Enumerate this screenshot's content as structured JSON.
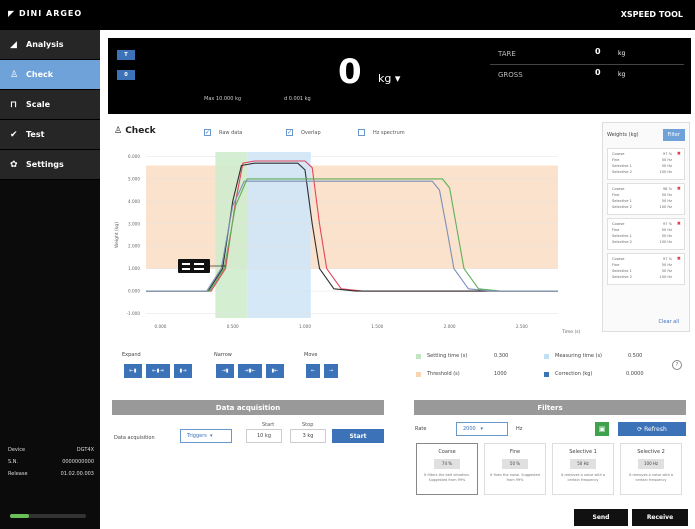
{
  "topbar": {
    "logo": "◤ DINI ARGEO",
    "app_title": "XSPEED TOOL"
  },
  "sidebar": {
    "items": [
      {
        "label": "Analysis",
        "icon": "chart-icon"
      },
      {
        "label": "Check",
        "icon": "check-user-icon"
      },
      {
        "label": "Scale",
        "icon": "scale-icon"
      },
      {
        "label": "Test",
        "icon": "checkmark-icon"
      },
      {
        "label": "Settings",
        "icon": "gear-icon"
      }
    ],
    "device": [
      {
        "label": "Device",
        "value": "DGT4X"
      },
      {
        "label": "S.N.",
        "value": "0000000000"
      },
      {
        "label": "Release",
        "value": "01.02.00.003"
      }
    ],
    "progress": 0.25
  },
  "display": {
    "btn_t": "T",
    "btn_0": "0",
    "weight": "0",
    "unit": "kg",
    "max": "Max 10.000 kg",
    "division": "d 0.001 kg",
    "tare_label": "TARE",
    "tare_value": "0",
    "tare_unit": "kg",
    "gross_label": "GROSS",
    "gross_value": "0",
    "gross_unit": "kg"
  },
  "check": {
    "title": "Check",
    "raw_data": "Raw data",
    "overlap": "Overlap",
    "hz_spectrum": "Hz spectrum",
    "raw_data_checked": true,
    "overlap_checked": true,
    "hz_spectrum_checked": false
  },
  "chart_data": {
    "type": "line",
    "ylabel": "Weight (kg)",
    "xlabel": "Time (s)",
    "yticks": [
      "6.000",
      "5.000",
      "4.000",
      "3.000",
      "2.000",
      "1.000",
      "0.000",
      "-1.000"
    ],
    "xticks": [
      "0.000",
      "0.500",
      "1.000",
      "1.500",
      "2.000",
      "2.500"
    ],
    "ylim": [
      -1.2,
      6.2
    ],
    "xlim": [
      -0.1,
      2.75
    ],
    "bands": [
      {
        "name": "threshold",
        "color": "#fbe2cc",
        "y": [
          1.0,
          5.6
        ]
      },
      {
        "name": "settling",
        "color": "#cfeccd",
        "x": [
          0.38,
          0.6
        ]
      },
      {
        "name": "measuring",
        "color": "#cfe5f7",
        "x": [
          0.6,
          1.04
        ]
      }
    ],
    "series": [
      {
        "color": "#e0465a",
        "x": [
          -0.1,
          0.35,
          0.45,
          0.52,
          0.57,
          0.65,
          1.0,
          1.05,
          1.1,
          1.15,
          1.25,
          1.4,
          2.75
        ],
        "y": [
          0,
          0,
          1.0,
          4.0,
          5.7,
          5.8,
          5.8,
          5.5,
          3.0,
          1.0,
          0.1,
          0,
          0
        ]
      },
      {
        "color": "#2f2f2f",
        "x": [
          -0.1,
          0.33,
          0.43,
          0.5,
          0.56,
          0.65,
          0.95,
          1.0,
          1.05,
          1.1,
          1.2,
          1.35,
          2.75
        ],
        "y": [
          0,
          0,
          1.0,
          4.0,
          5.6,
          5.7,
          5.7,
          5.4,
          3.0,
          1.0,
          0.1,
          0,
          0
        ]
      },
      {
        "color": "#5db05a",
        "x": [
          -0.1,
          0.34,
          0.44,
          0.52,
          0.6,
          0.7,
          1.95,
          2.0,
          2.05,
          2.1,
          2.2,
          2.35,
          2.75
        ],
        "y": [
          0,
          0,
          1.0,
          3.8,
          5.0,
          5.0,
          5.0,
          4.6,
          2.8,
          1.0,
          0.1,
          0,
          0
        ]
      },
      {
        "color": "#7a8fb8",
        "x": [
          -0.1,
          0.32,
          0.42,
          0.5,
          0.58,
          0.68,
          1.88,
          1.93,
          1.98,
          2.03,
          2.13,
          2.28,
          2.75
        ],
        "y": [
          0,
          0,
          1.0,
          3.8,
          4.9,
          4.9,
          4.9,
          4.5,
          2.8,
          1.0,
          0.1,
          0,
          0
        ]
      }
    ]
  },
  "weights_panel": {
    "title": "Weights (kg)",
    "filter_label": "Filter",
    "clear_all": "Clear all",
    "cards": [
      {
        "rows": [
          [
            "Coarse",
            "97 %"
          ],
          [
            "Fine",
            "50 Hz"
          ],
          [
            "Selective 1",
            "50 Hz"
          ],
          [
            "Selective 2",
            "100 Hz"
          ]
        ]
      },
      {
        "rows": [
          [
            "Coarse",
            "98 %"
          ],
          [
            "Fine",
            "50 Hz"
          ],
          [
            "Selective 1",
            "50 Hz"
          ],
          [
            "Selective 2",
            "100 Hz"
          ]
        ]
      },
      {
        "rows": [
          [
            "Coarse",
            "97 %"
          ],
          [
            "Fine",
            "50 Hz"
          ],
          [
            "Selective 1",
            "50 Hz"
          ],
          [
            "Selective 2",
            "100 Hz"
          ]
        ]
      },
      {
        "rows": [
          [
            "Coarse",
            "97 %"
          ],
          [
            "Fine",
            "50 Hz"
          ],
          [
            "Selective 1",
            "50 Hz"
          ],
          [
            "Selective 2",
            "100 Hz"
          ]
        ]
      }
    ]
  },
  "controls": {
    "expand": "Expand",
    "narrow": "Narrow",
    "move": "Move"
  },
  "stats": {
    "settling_label": "Settling time (s)",
    "settling_value": "0.300",
    "measuring_label": "Measuring time (s)",
    "measuring_value": "0.500",
    "threshold_label": "Threshold (s)",
    "threshold_value": "1000",
    "correction_label": "Correction (kg)",
    "correction_value": "0.0000",
    "colors": {
      "settling": "#bfe6bf",
      "measuring": "#bfe0f5",
      "threshold": "#f8d4b0",
      "correction": "#3b72b8"
    }
  },
  "acquisition": {
    "header": "Data acquisition",
    "label": "Data acquisition",
    "mode": "Triggers",
    "start_label": "Start",
    "start_value": "10 kg",
    "stop_label": "Stop",
    "stop_value": "3 kg",
    "start_button": "Start"
  },
  "filters": {
    "header": "Filters",
    "rate_label": "Rate",
    "rate_value": "2000",
    "hz": "Hz",
    "refresh": "Refresh",
    "cards": [
      {
        "title": "Coarse",
        "value": "74 %",
        "desc": "It filters the belt vibration. Suggested from 99%"
      },
      {
        "title": "Fine",
        "value": "50 %",
        "desc": "It fixes the noise. Suggested from 99%"
      },
      {
        "title": "Selective 1",
        "value": "50 Hz",
        "desc": "It removes a noise with a certain frequency"
      },
      {
        "title": "Selective 2",
        "value": "100 Hz",
        "desc": "It removes a noise with a certain frequency"
      }
    ]
  },
  "footer": {
    "send": "Send",
    "receive": "Receive"
  }
}
